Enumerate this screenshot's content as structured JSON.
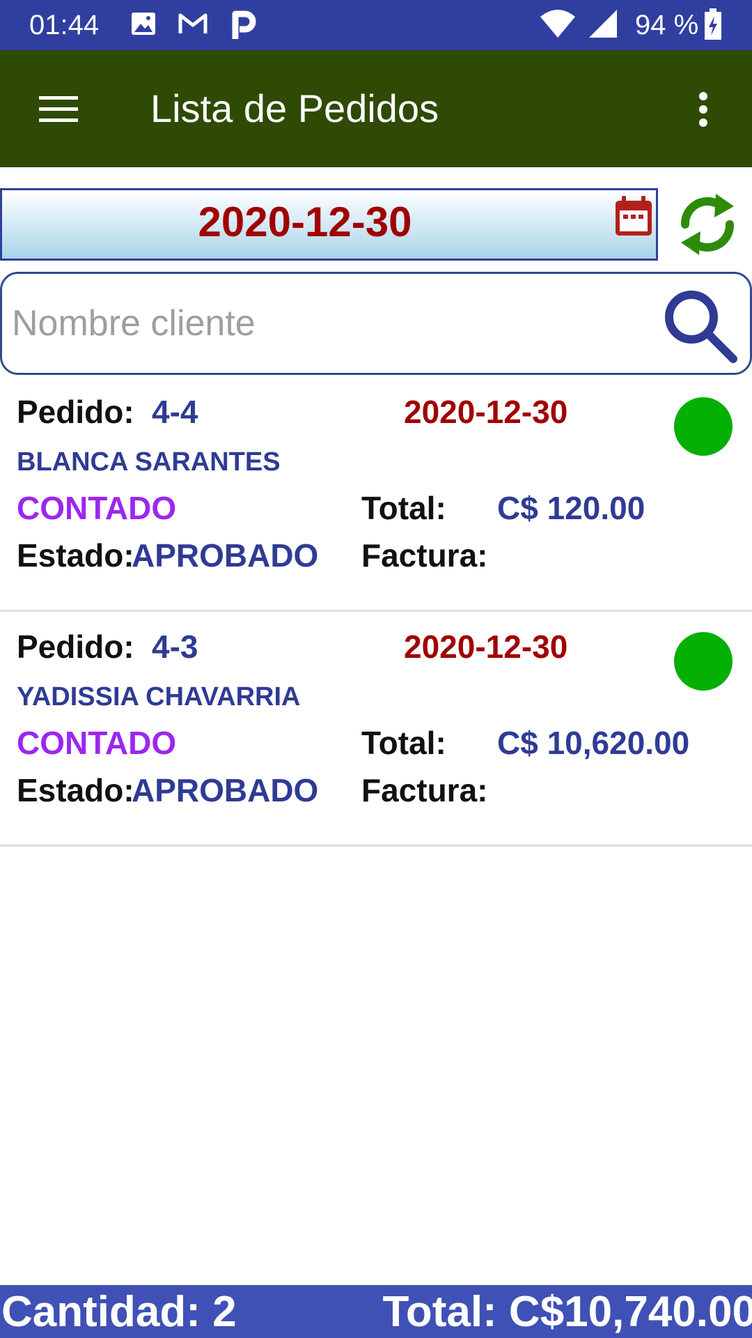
{
  "status_bar": {
    "time": "01:44",
    "battery": "94 %",
    "notification_icons": [
      "image-icon",
      "gmail-icon",
      "p-app-icon"
    ],
    "system_icons": [
      "wifi-icon",
      "signal-icon",
      "battery-charging-icon"
    ]
  },
  "app_bar": {
    "title": "Lista de Pedidos",
    "menu_icon": "hamburger-icon",
    "overflow_icon": "more-vert-icon",
    "background": "#2e4a04"
  },
  "filter": {
    "date": "2020-12-30",
    "calendar_icon": "calendar-icon",
    "refresh_icon": "refresh-icon",
    "search_placeholder": "Nombre cliente",
    "search_value": "",
    "search_icon": "search-icon"
  },
  "labels": {
    "pedido": "Pedido:",
    "total": "Total:",
    "estado": "Estado:",
    "factura": "Factura:"
  },
  "orders": [
    {
      "number": "4-4",
      "date": "2020-12-30",
      "client": "BLANCA SARANTES",
      "payment_type": "CONTADO",
      "total": "C$ 120.00",
      "status": "APROBADO",
      "invoice": "",
      "status_color": "#04b004"
    },
    {
      "number": "4-3",
      "date": "2020-12-30",
      "client": "YADISSIA CHAVARRIA",
      "payment_type": "CONTADO",
      "total": "C$ 10,620.00",
      "status": "APROBADO",
      "invoice": "",
      "status_color": "#04b004"
    }
  ],
  "footer": {
    "count": "Cantidad: 2",
    "total": "Total: C$10,740.00"
  },
  "colors": {
    "status_bar": "#303f9f",
    "footer": "#3f51b5",
    "date_red": "#a00000",
    "value_blue": "#2f3b94",
    "payment_purple": "#9c27f0",
    "status_green": "#04b004"
  }
}
